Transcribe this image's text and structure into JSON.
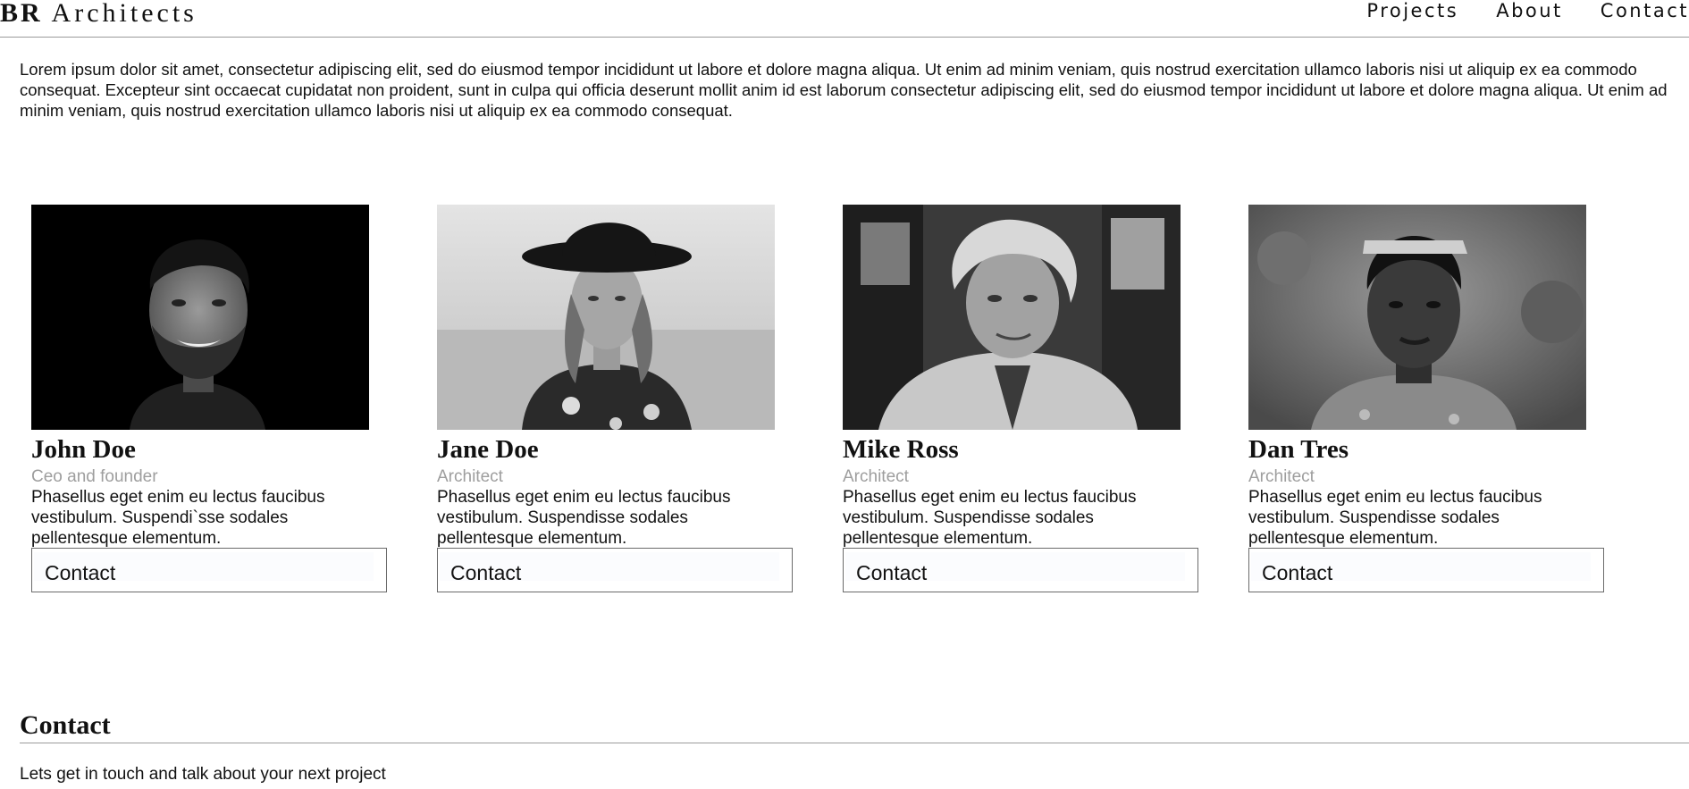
{
  "header": {
    "brand_bold": "BR",
    "brand_rest": "Architects",
    "nav": [
      "Projects",
      "About",
      "Contact"
    ]
  },
  "intro": "Lorem ipsum dolor sit amet, consectetur adipiscing elit, sed do eiusmod tempor incididunt ut labore et dolore magna aliqua. Ut enim ad minim veniam, quis nostrud exercitation ullamco laboris nisi ut aliquip ex ea commodo consequat. Excepteur sint occaecat cupidatat non proident, sunt in culpa qui officia deserunt mollit anim id est laborum consectetur adipiscing elit, sed do eiusmod tempor incididunt ut labore et dolore magna aliqua. Ut enim ad minim veniam, quis nostrud exercitation ullamco laboris nisi ut aliquip ex ea commodo consequat.",
  "team": [
    {
      "name": "John Doe",
      "role": "Ceo and founder",
      "description": "Phasellus eget enim eu lectus faucibus vestibulum. Suspendi`sse sodales pellentesque elementum.",
      "button": "Contact"
    },
    {
      "name": "Jane Doe",
      "role": "Architect",
      "description": "Phasellus eget enim eu lectus faucibus vestibulum. Suspendisse sodales pellentesque elementum.",
      "button": "Contact"
    },
    {
      "name": "Mike Ross",
      "role": "Architect",
      "description": "Phasellus eget enim eu lectus faucibus vestibulum. Suspendisse sodales pellentesque elementum.",
      "button": "Contact"
    },
    {
      "name": "Dan Tres",
      "role": "Architect",
      "description": "Phasellus eget enim eu lectus faucibus vestibulum. Suspendisse sodales pellentesque elementum.",
      "button": "Contact"
    }
  ],
  "contact": {
    "title": "Contact",
    "subtitle": "Lets get in touch and talk about your next project"
  }
}
